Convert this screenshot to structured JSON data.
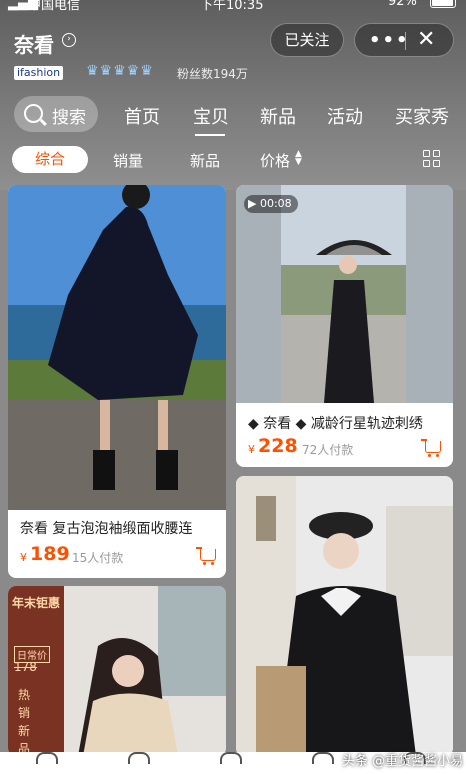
{
  "status_bar": {
    "carrier": "中国电信",
    "time": "下午10:35",
    "battery": "92%"
  },
  "store": {
    "name": "奈看",
    "badge": "ifashion",
    "crown_icons": "♛♛♛♛♛",
    "fans": "粉丝数194万",
    "follow_label": "已关注",
    "more_label": "•••",
    "close_label": "✕"
  },
  "nav": {
    "search_label": "搜索",
    "tabs": [
      {
        "label": "首页"
      },
      {
        "label": "宝贝",
        "active": true
      },
      {
        "label": "新品"
      },
      {
        "label": "活动"
      },
      {
        "label": "买家秀"
      }
    ]
  },
  "sort": {
    "items": [
      {
        "label": "综合",
        "active": true
      },
      {
        "label": "销量"
      },
      {
        "label": "新品"
      },
      {
        "label": "价格"
      }
    ]
  },
  "products": [
    {
      "title": "奈看  复古泡泡袖缎面收腰连",
      "currency": "¥",
      "price": "189",
      "sold": "15人付款"
    },
    {
      "title": "◆ 奈看 ◆ 减龄行星轨迹刺绣",
      "currency": "¥",
      "price": "228",
      "sold": "72人付款",
      "video_time": "00:08"
    },
    {
      "promo_title": "年末钜惠",
      "promo_day": "日常价",
      "promo_price": "178",
      "promo_text": "热销新品拍"
    },
    {}
  ],
  "watermark": "头条 @重货酱酱小易",
  "colors": {
    "accent": "#ff5000",
    "header": "#6e6e6e"
  }
}
